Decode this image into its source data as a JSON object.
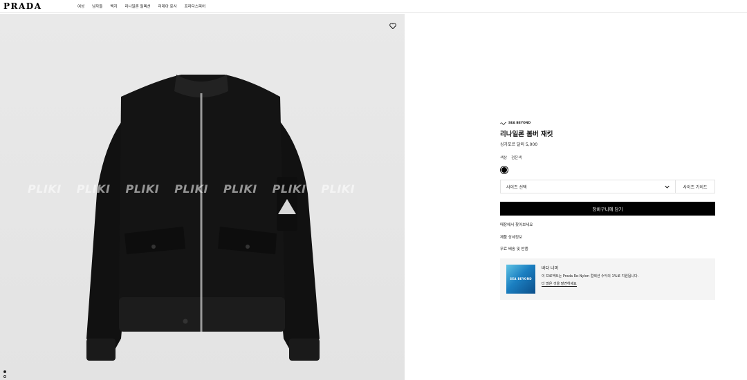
{
  "header": {
    "logo": "PRADA",
    "nav": [
      "여성",
      "남자들",
      "백지",
      "리나일론 컬렉션",
      "리데아 로사",
      "프라다스피어"
    ]
  },
  "image": {
    "watermark": [
      "PLIKI",
      "PLIKI",
      "PLIKI",
      "PLIKI",
      "PLIKI",
      "PLIKI",
      "PLIKI"
    ],
    "carousel_dots": 2,
    "favorite_icon": "heart-icon"
  },
  "product": {
    "brand_mark": "SEA BEYOND",
    "title": "리나일론 봄버 재킷",
    "price": "싱가포르 달러 5,000",
    "color_label": "색상",
    "color_value": "검은색",
    "size_select": "사이즈 선택",
    "size_guide": "사이즈 가이드",
    "add_to_cart": "장바구니에 담기",
    "links": [
      "매장에서 찾아보세요",
      "제품 상세정보",
      "무료 배송 및 반품"
    ]
  },
  "promo": {
    "image_label": "SEA BEYOND",
    "title": "바다 너머",
    "text": "이 프로젝트는 Prada Re-Nylon 컬렉션 수익의 1%로 지원됩니다.",
    "link": "더 많은 것을 발견하세요"
  },
  "colors": {
    "accent": "#000000",
    "panel_bg": "#e6e6e6",
    "promo_bg": "#f4f4f4"
  }
}
